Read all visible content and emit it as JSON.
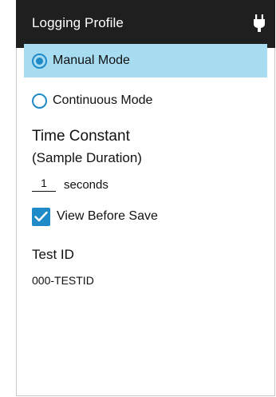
{
  "header": {
    "title": "Logging Profile",
    "icon": "plug-icon"
  },
  "mode_options": [
    {
      "label": "Manual Mode",
      "selected": true
    },
    {
      "label": "Continuous Mode",
      "selected": false
    }
  ],
  "time_constant": {
    "title": "Time Constant",
    "subtitle": "(Sample Duration)",
    "value": "1",
    "unit": "seconds"
  },
  "view_before_save": {
    "label": "View Before Save",
    "checked": true
  },
  "test_id": {
    "label": "Test ID",
    "value": "000-TESTID"
  },
  "colors": {
    "header_bg": "#1f1f1f",
    "selected_bg": "#a7dcf1",
    "accent": "#1e8ac8"
  }
}
